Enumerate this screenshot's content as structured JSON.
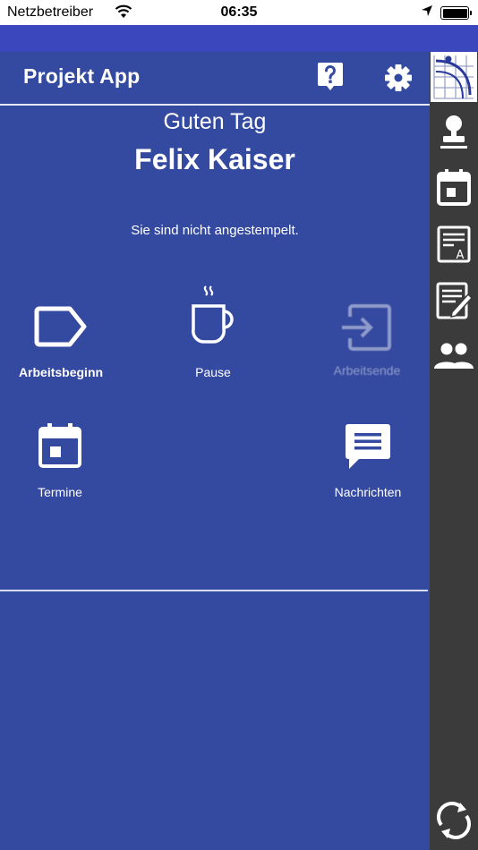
{
  "status_bar": {
    "carrier": "Netzbetreiber",
    "time": "06:35"
  },
  "header": {
    "title": "Projekt App"
  },
  "main": {
    "greeting": "Guten Tag",
    "user_name": "Felix Kaiser",
    "stamp_status": "Sie sind nicht angestempelt.",
    "actions": {
      "work_start": "Arbeitsbeginn",
      "pause": "Pause",
      "work_end": "Arbeitsende",
      "appointments": "Termine",
      "messages": "Nachrichten"
    }
  },
  "sidebar": {
    "items": [
      "stamp-icon",
      "calendar-icon",
      "document-a-icon",
      "edit-note-icon",
      "people-icon",
      "sync-icon"
    ]
  },
  "colors": {
    "background": "#3449a0",
    "accent_strip": "#3b47bd",
    "sidebar": "#3b3b3b"
  }
}
